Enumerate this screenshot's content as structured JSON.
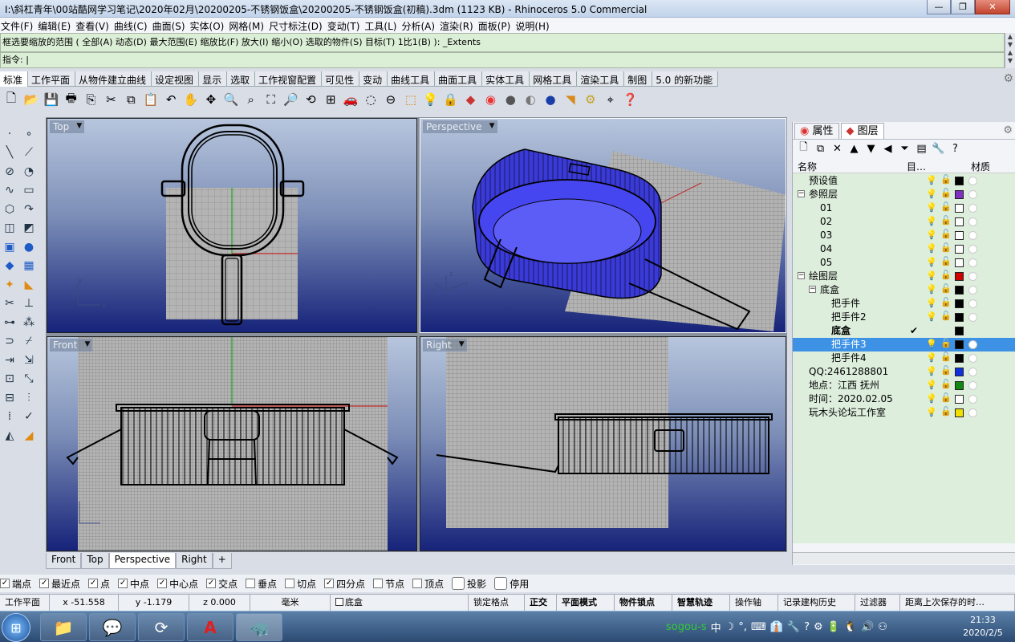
{
  "window": {
    "title": "I:\\斜杠青年\\00站酷网学习笔记\\2020年02月\\20200205-不锈钢饭盒\\20200205-不锈钢饭盒(初稿).3dm (1123 KB) - Rhinoceros 5.0 Commercial",
    "minimize": "—",
    "restore": "❐",
    "close": "✕"
  },
  "menu": [
    "文件(F)",
    "编辑(E)",
    "查看(V)",
    "曲线(C)",
    "曲面(S)",
    "实体(O)",
    "网格(M)",
    "尺寸标注(D)",
    "变动(T)",
    "工具(L)",
    "分析(A)",
    "渲染(R)",
    "面板(P)",
    "说明(H)"
  ],
  "command": {
    "history": "框选要缩放的范围 ( 全部(A) 动态(D) 最大范围(E) 缩放比(F) 放大(I) 缩小(O) 选取的物件(S) 目标(T) 1比1(B) ): _Extents",
    "prompt": "指令: |"
  },
  "toolbar_tabs": [
    "标准",
    "工作平面",
    "从物件建立曲线",
    "设定视图",
    "显示",
    "选取",
    "工作视窗配置",
    "可见性",
    "变动",
    "曲线工具",
    "曲面工具",
    "实体工具",
    "网格工具",
    "渲染工具",
    "制图",
    "5.0 的新功能"
  ],
  "toolbar_icons": [
    "new-file",
    "open-folder",
    "save",
    "print",
    "import",
    "cut",
    "copy",
    "paste",
    "undo",
    "pan-hand",
    "rotate-view",
    "zoom-window",
    "zoom-dynamic",
    "zoom-extents",
    "zoom-selected",
    "rotate-3d",
    "four-views",
    "car-object",
    "hide",
    "cplane",
    "snap",
    "light",
    "lock",
    "layer",
    "color-wheel",
    "shaded-sphere",
    "render-sphere",
    "ghost-sphere",
    "render-preview",
    "gear",
    "coordinates",
    "help"
  ],
  "left_tools": [
    "point",
    "dot-tools",
    "line",
    "polyline",
    "circle",
    "arc",
    "curve",
    "rectangle",
    "polygon",
    "free-curve",
    "surface",
    "surface-pt",
    "box",
    "sphere",
    "solid",
    "mesh",
    "boolean",
    "fillet",
    "trim",
    "split",
    "join",
    "explode",
    "group",
    "array",
    "move",
    "copy",
    "rotate",
    "scale",
    "mirror",
    "offset",
    "dimension",
    "check",
    "text",
    "render"
  ],
  "viewports": [
    {
      "title": "Top",
      "active": false
    },
    {
      "title": "Perspective",
      "active": true
    },
    {
      "title": "Front",
      "active": false
    },
    {
      "title": "Right",
      "active": false
    }
  ],
  "viewport_tabs": [
    "Front",
    "Top",
    "Perspective",
    "Right",
    "+"
  ],
  "panel": {
    "tabs": [
      "属性",
      "图层"
    ],
    "columns": {
      "name": "名称",
      "current": "目…",
      "material": "材质"
    },
    "layers": [
      {
        "name": "预设值",
        "level": 0,
        "expand": "",
        "bulb": "yellow",
        "color": "#000000",
        "current": false,
        "selected": false
      },
      {
        "name": "参照层",
        "level": 0,
        "expand": "⊟",
        "bulb": "yellow",
        "color": "#8030c0",
        "current": false,
        "selected": false
      },
      {
        "name": "01",
        "level": 1,
        "expand": "",
        "bulb": "blue",
        "color": "#ffffff",
        "current": false,
        "selected": false
      },
      {
        "name": "02",
        "level": 1,
        "expand": "",
        "bulb": "blue",
        "color": "#ffffff",
        "current": false,
        "selected": false
      },
      {
        "name": "03",
        "level": 1,
        "expand": "",
        "bulb": "blue",
        "color": "#ffffff",
        "current": false,
        "selected": false
      },
      {
        "name": "04",
        "level": 1,
        "expand": "",
        "bulb": "blue",
        "color": "#ffffff",
        "current": false,
        "selected": false
      },
      {
        "name": "05",
        "level": 1,
        "expand": "",
        "bulb": "blue",
        "color": "#ffffff",
        "current": false,
        "selected": false
      },
      {
        "name": "绘图层",
        "level": 0,
        "expand": "⊟",
        "bulb": "yellow",
        "color": "#cc0000",
        "current": false,
        "selected": false
      },
      {
        "name": "底盒",
        "level": 1,
        "expand": "⊟",
        "bulb": "yellow",
        "color": "#000000",
        "current": false,
        "selected": false
      },
      {
        "name": "把手件",
        "level": 2,
        "expand": "",
        "bulb": "yellow",
        "color": "#000000",
        "current": false,
        "selected": false
      },
      {
        "name": "把手件2",
        "level": 2,
        "expand": "",
        "bulb": "yellow",
        "color": "#000000",
        "current": false,
        "selected": false
      },
      {
        "name": "底盒",
        "level": 2,
        "expand": "",
        "bulb": "none",
        "color": "#000000",
        "current": true,
        "selected": false
      },
      {
        "name": "把手件3",
        "level": 2,
        "expand": "",
        "bulb": "yellow",
        "color": "#000000",
        "current": false,
        "selected": true
      },
      {
        "name": "把手件4",
        "level": 2,
        "expand": "",
        "bulb": "yellow",
        "color": "#000000",
        "current": false,
        "selected": false
      },
      {
        "name": "QQ:2461288801",
        "level": 0,
        "expand": "",
        "bulb": "yellow",
        "color": "#1030e0",
        "current": false,
        "selected": false
      },
      {
        "name": "地点：江西 抚州",
        "level": 0,
        "expand": "",
        "bulb": "yellow",
        "color": "#118811",
        "current": false,
        "selected": false
      },
      {
        "name": "时间：2020.02.05",
        "level": 0,
        "expand": "",
        "bulb": "yellow",
        "color": "#ffffff",
        "current": false,
        "selected": false
      },
      {
        "name": "玩木头论坛工作室",
        "level": 0,
        "expand": "",
        "bulb": "yellow",
        "color": "#f0e000",
        "current": false,
        "selected": false
      }
    ]
  },
  "osnaps": [
    {
      "label": "端点",
      "checked": true
    },
    {
      "label": "最近点",
      "checked": true
    },
    {
      "label": "点",
      "checked": true
    },
    {
      "label": "中点",
      "checked": true
    },
    {
      "label": "中心点",
      "checked": true
    },
    {
      "label": "交点",
      "checked": true
    },
    {
      "label": "垂点",
      "checked": false
    },
    {
      "label": "切点",
      "checked": false
    },
    {
      "label": "四分点",
      "checked": true
    },
    {
      "label": "节点",
      "checked": false
    },
    {
      "label": "顶点",
      "checked": false
    },
    {
      "label": "投影",
      "checked": false
    },
    {
      "label": "停用",
      "checked": false
    }
  ],
  "status": {
    "cplane": "工作平面",
    "x": "x -51.558",
    "y": "y -1.179",
    "z": "z 0.000",
    "units": "毫米",
    "layer": "底盒",
    "grid_snap": "锁定格点",
    "ortho": "正交",
    "planar": "平面模式",
    "osnap": "物件锁点",
    "smarttrack": "智慧轨迹",
    "gumball": "操作轴",
    "history": "记录建构历史",
    "filter": "过滤器",
    "autosave": "距离上次保存的时…"
  },
  "taskbar": {
    "time": "21:33",
    "date": "2020/2/5",
    "apps": [
      "file-explorer",
      "wechat",
      "browser",
      "autocad",
      "rhino"
    ],
    "tray": [
      "sogou-s",
      "中",
      "☽",
      "°,",
      "⌨",
      "👔",
      "🔧",
      "?",
      "⚙",
      "🔋",
      "🐧",
      "🔊",
      "⚇"
    ]
  }
}
